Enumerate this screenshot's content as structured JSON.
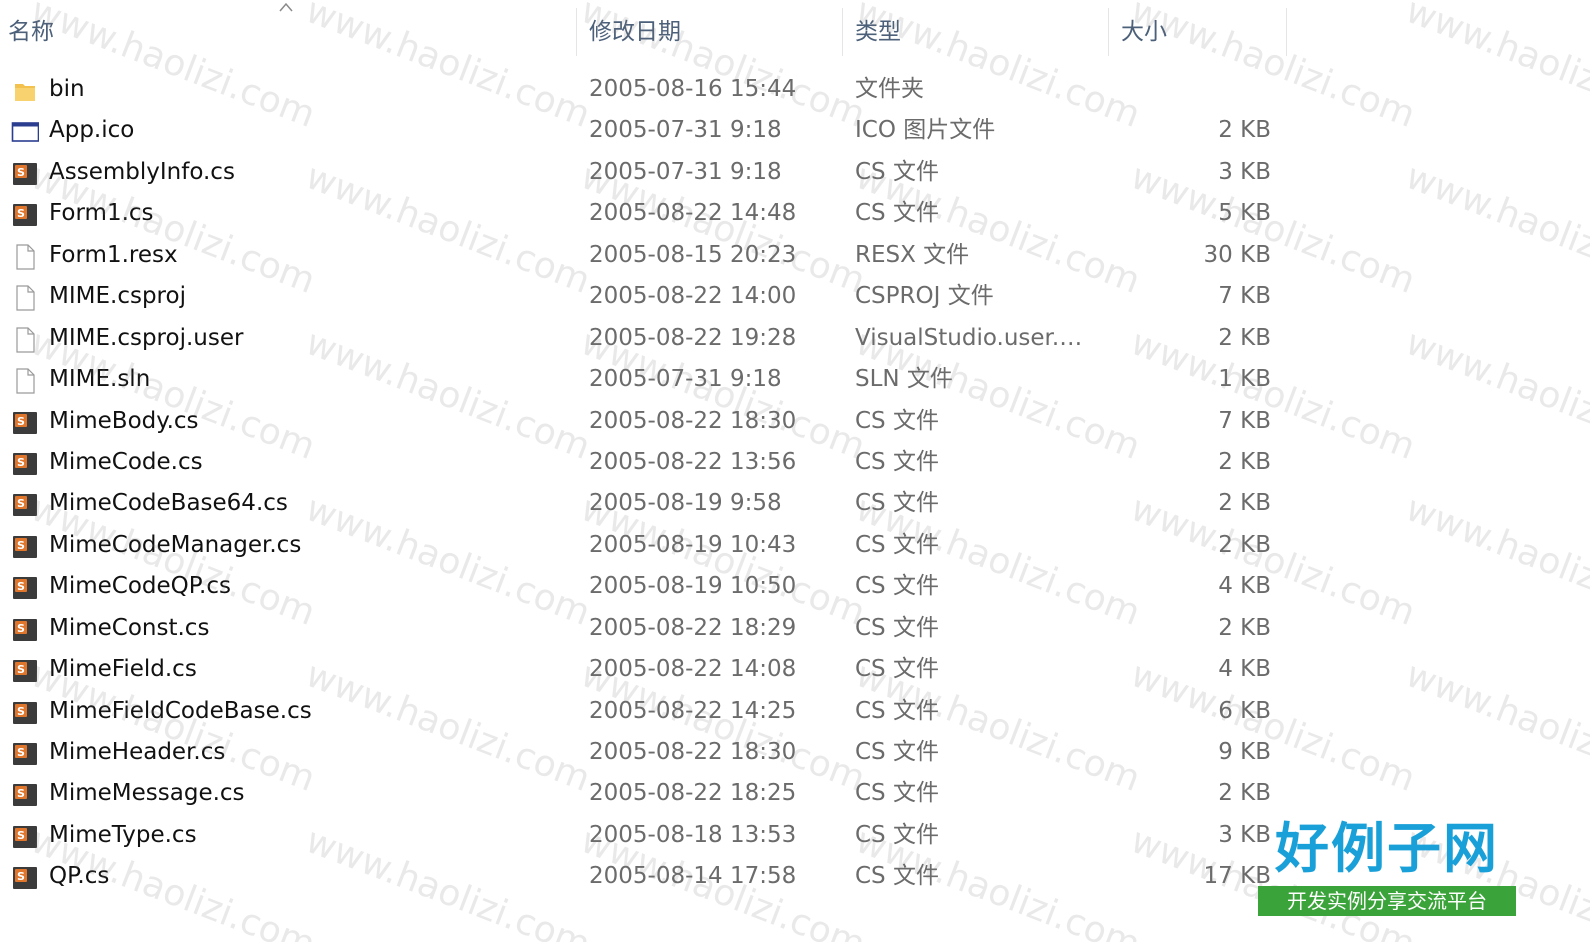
{
  "header": {
    "name": "名称",
    "date": "修改日期",
    "type": "类型",
    "size": "大小"
  },
  "files": [
    {
      "name": "bin",
      "date": "2005-08-16 15:44",
      "type": "文件夹",
      "size": "",
      "icon": "folder-icon"
    },
    {
      "name": "App.ico",
      "date": "2005-07-31 9:18",
      "type": "ICO 图片文件",
      "size": "2 KB",
      "icon": "ico-file-icon"
    },
    {
      "name": "AssemblyInfo.cs",
      "date": "2005-07-31 9:18",
      "type": "CS 文件",
      "size": "3 KB",
      "icon": "cs-file-icon"
    },
    {
      "name": "Form1.cs",
      "date": "2005-08-22 14:48",
      "type": "CS 文件",
      "size": "5 KB",
      "icon": "cs-file-icon"
    },
    {
      "name": "Form1.resx",
      "date": "2005-08-15 20:23",
      "type": "RESX 文件",
      "size": "30 KB",
      "icon": "blank-file-icon"
    },
    {
      "name": "MIME.csproj",
      "date": "2005-08-22 14:00",
      "type": "CSPROJ 文件",
      "size": "7 KB",
      "icon": "blank-file-icon"
    },
    {
      "name": "MIME.csproj.user",
      "date": "2005-08-22 19:28",
      "type": "VisualStudio.user.a...",
      "size": "2 KB",
      "icon": "blank-file-icon"
    },
    {
      "name": "MIME.sln",
      "date": "2005-07-31 9:18",
      "type": "SLN 文件",
      "size": "1 KB",
      "icon": "blank-file-icon"
    },
    {
      "name": "MimeBody.cs",
      "date": "2005-08-22 18:30",
      "type": "CS 文件",
      "size": "7 KB",
      "icon": "cs-file-icon"
    },
    {
      "name": "MimeCode.cs",
      "date": "2005-08-22 13:56",
      "type": "CS 文件",
      "size": "2 KB",
      "icon": "cs-file-icon"
    },
    {
      "name": "MimeCodeBase64.cs",
      "date": "2005-08-19 9:58",
      "type": "CS 文件",
      "size": "2 KB",
      "icon": "cs-file-icon"
    },
    {
      "name": "MimeCodeManager.cs",
      "date": "2005-08-19 10:43",
      "type": "CS 文件",
      "size": "2 KB",
      "icon": "cs-file-icon"
    },
    {
      "name": "MimeCodeQP.cs",
      "date": "2005-08-19 10:50",
      "type": "CS 文件",
      "size": "4 KB",
      "icon": "cs-file-icon"
    },
    {
      "name": "MimeConst.cs",
      "date": "2005-08-22 18:29",
      "type": "CS 文件",
      "size": "2 KB",
      "icon": "cs-file-icon"
    },
    {
      "name": "MimeField.cs",
      "date": "2005-08-22 14:08",
      "type": "CS 文件",
      "size": "4 KB",
      "icon": "cs-file-icon"
    },
    {
      "name": "MimeFieldCodeBase.cs",
      "date": "2005-08-22 14:25",
      "type": "CS 文件",
      "size": "6 KB",
      "icon": "cs-file-icon"
    },
    {
      "name": "MimeHeader.cs",
      "date": "2005-08-22 18:30",
      "type": "CS 文件",
      "size": "9 KB",
      "icon": "cs-file-icon"
    },
    {
      "name": "MimeMessage.cs",
      "date": "2005-08-22 18:25",
      "type": "CS 文件",
      "size": "2 KB",
      "icon": "cs-file-icon"
    },
    {
      "name": "MimeType.cs",
      "date": "2005-08-18 13:53",
      "type": "CS 文件",
      "size": "3 KB",
      "icon": "cs-file-icon"
    },
    {
      "name": "QP.cs",
      "date": "2005-08-14 17:58",
      "type": "CS 文件",
      "size": "17 KB",
      "icon": "cs-file-icon"
    }
  ],
  "watermark": {
    "text": "www.haolizi.com",
    "logo_main": "好例子网",
    "logo_sub": "开发实例分享交流平台"
  },
  "colors": {
    "header_text": "#4c607a",
    "folder": "#f2c14e",
    "cs_icon": "#e0752c",
    "logo_blue": "#1aa0d8",
    "logo_green": "#3aa33a"
  }
}
